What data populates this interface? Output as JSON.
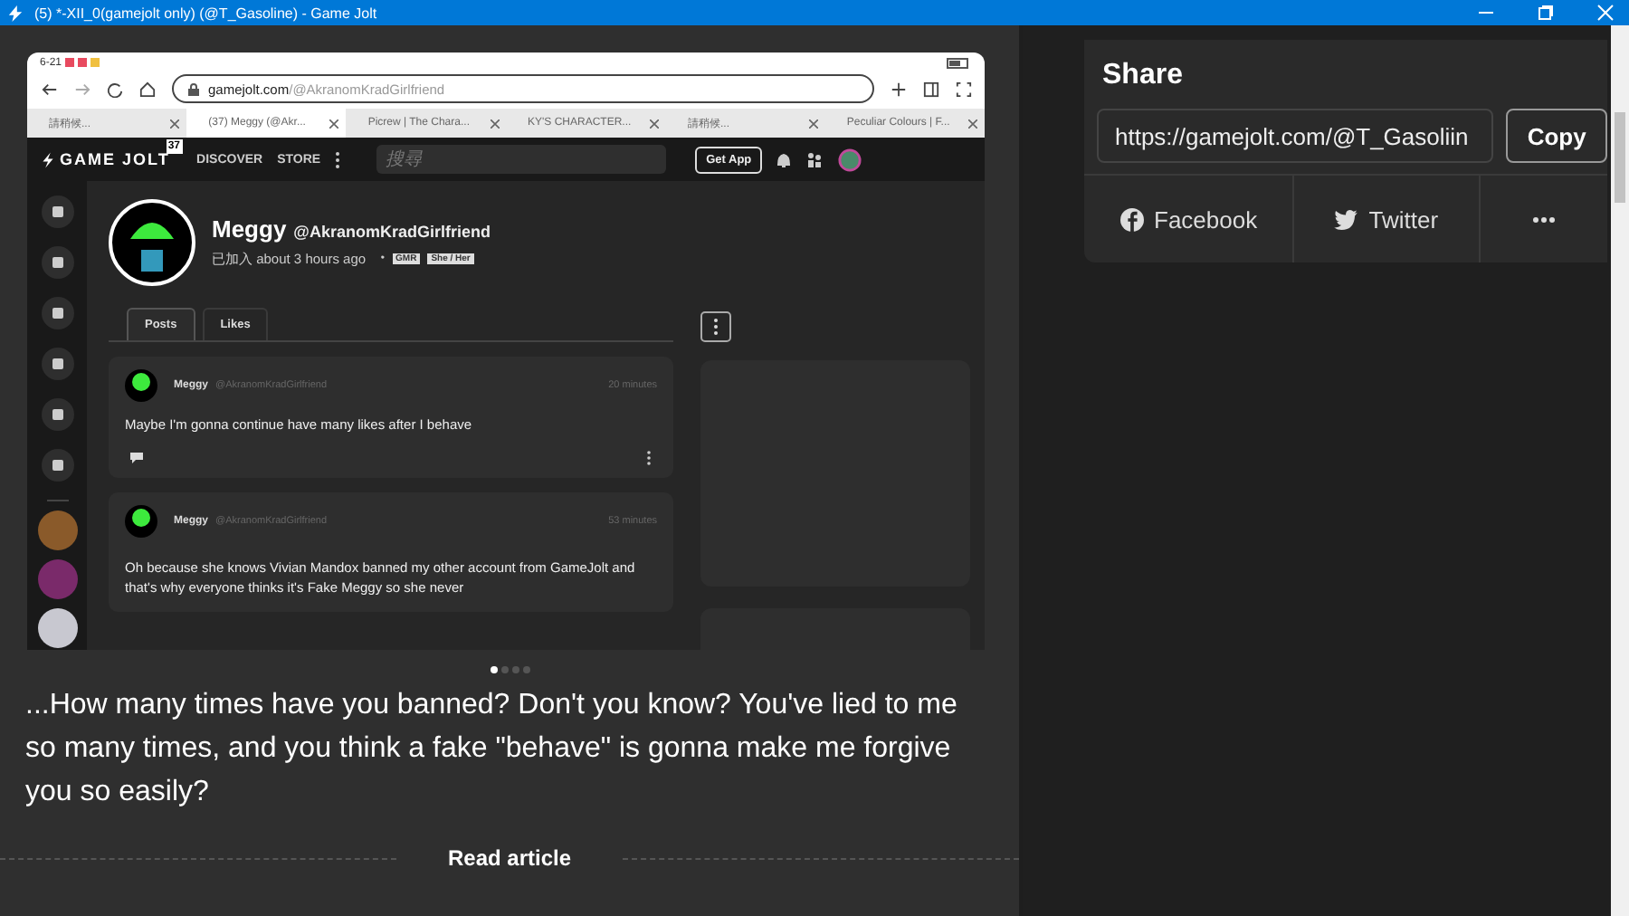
{
  "window": {
    "title": "(5) *-XII_0(gamejolt only) (@T_Gasoline) - Game Jolt"
  },
  "post_image": {
    "status_time": "6-21",
    "address": {
      "domain": "gamejolt.com",
      "path": "/@AkranomKradGirlfriend"
    },
    "browser_tabs": [
      {
        "label": "請稍候...",
        "selected": false
      },
      {
        "label": "(37) Meggy (@Akr...",
        "selected": true
      },
      {
        "label": "Picrew | The Chara...",
        "selected": false
      },
      {
        "label": "KY'S CHARACTER...",
        "selected": false
      },
      {
        "label": "請稍候...",
        "selected": false
      },
      {
        "label": "Peculiar Colours | F...",
        "selected": false
      }
    ],
    "site": {
      "logo": "GAME JOLT",
      "logo_badge": "37",
      "nav": [
        "DISCOVER",
        "STORE"
      ],
      "search": {
        "placeholder": "搜尋"
      },
      "get_app": "Get App"
    },
    "profile": {
      "name": "Meggy",
      "handle": "@AkranomKradGirlfriend",
      "joined": "已加入 about 3 hours ago",
      "separator": "•",
      "tags": [
        "GMR",
        "She / Her"
      ]
    },
    "profile_tabs": [
      {
        "label": "Posts",
        "selected": true
      },
      {
        "label": "Likes",
        "selected": false
      }
    ],
    "posts": [
      {
        "name": "Meggy",
        "handle": "@AkranomKradGirlfriend",
        "time": "20 minutes",
        "text": "Maybe I'm gonna continue have many likes after I behave"
      },
      {
        "name": "Meggy",
        "handle": "@AkranomKradGirlfriend",
        "time": "53 minutes",
        "text": "Oh because she knows Vivian Mandox banned my other account from GameJolt and that's why everyone thinks it's Fake Meggy so she never"
      }
    ]
  },
  "carousel": [
    {
      "selected": true
    },
    {
      "selected": false
    },
    {
      "selected": false
    },
    {
      "selected": false
    }
  ],
  "caption": "...How many times have you banned? Don't you know? You've lied to me so many times, and you think a fake \"behave\" is gonna make me forgive you so easily?",
  "read_article": "Read article",
  "share": {
    "title": "Share",
    "url": "https://gamejolt.com/@T_Gasoliin",
    "copy": "Copy",
    "buttons": [
      {
        "kind": "facebook",
        "label": "Facebook"
      },
      {
        "kind": "twitter",
        "label": "Twitter"
      },
      {
        "kind": "more"
      }
    ]
  }
}
